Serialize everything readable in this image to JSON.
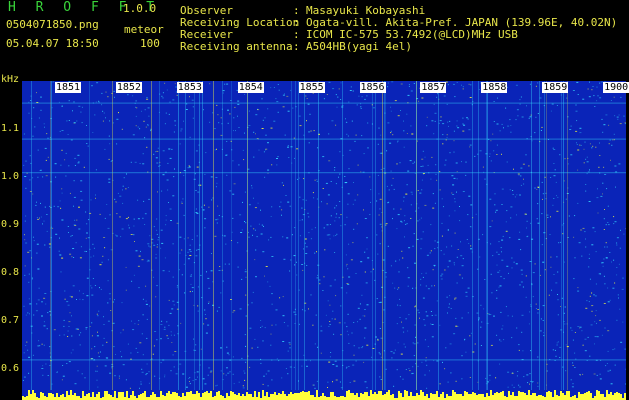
{
  "header": {
    "app_title": "H R O F F T",
    "app_version": "1.0.0",
    "file_name": "0504071850.png",
    "mode": "meteor",
    "datetime": "05.04.07 18:50",
    "count": "100",
    "info": [
      {
        "label": "Observer",
        "value": "Masayuki Kobayashi"
      },
      {
        "label": "Receiving Location",
        "value": "Ogata-vill. Akita-Pref. JAPAN (139.96E, 40.02N)"
      },
      {
        "label": "Receiver",
        "value": "ICOM IC-575 53.7492(@LCD)MHz USB"
      },
      {
        "label": "Receiving antenna",
        "value": "A504HB(yagi 4el)"
      }
    ]
  },
  "axis": {
    "unit": "kHz",
    "ticks": [
      "1.1",
      "1.0",
      "0.9",
      "0.8",
      "0.7",
      "0.6"
    ],
    "tick_values": [
      1.1,
      1.0,
      0.9,
      0.8,
      0.7,
      0.6
    ],
    "range_khz": [
      0.6,
      1.2
    ]
  },
  "hours": [
    "1851",
    "1852",
    "1853",
    "1854",
    "1855",
    "1856",
    "1857",
    "1858",
    "1859",
    "1900"
  ],
  "colors": {
    "background": "#000000",
    "spectrum_base": "#0a24b8",
    "text_green": "#39d43a",
    "text_yellow": "#e8e64a",
    "text_white": "#f2f2f2",
    "signal": "#35d6ff",
    "peak": "#ffff3a"
  }
}
